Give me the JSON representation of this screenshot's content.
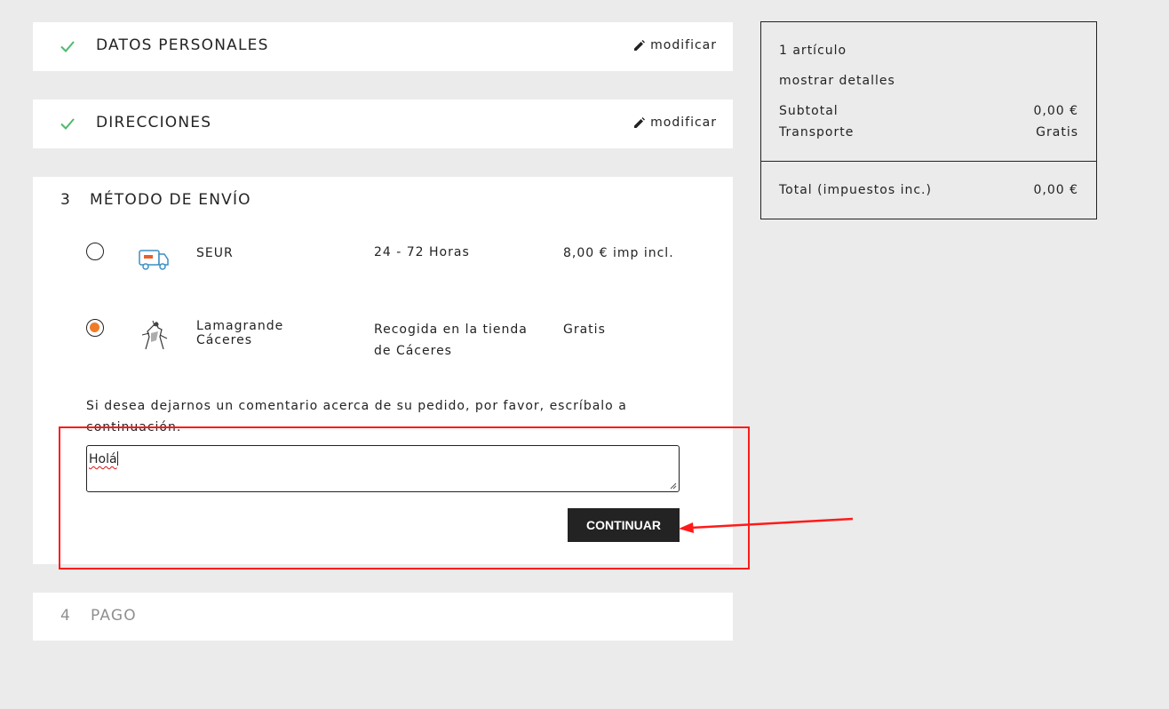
{
  "steps": {
    "personal": {
      "title": "DATOS PERSONALES",
      "modify_label": "modificar"
    },
    "addresses": {
      "title": "DIRECCIONES",
      "modify_label": "modificar"
    },
    "shipping": {
      "number": "3",
      "title": "MÉTODO DE ENVÍO",
      "carriers": [
        {
          "name": "SEUR",
          "delay": "24 - 72 Horas",
          "price": "8,00 € imp incl.",
          "selected": false,
          "logo_icon": "delivery-van-icon"
        },
        {
          "name_line1": "Lamagrande",
          "name_line2": "Cáceres",
          "delay_line1": "Recogida en la tienda",
          "delay_line2": "de Cáceres",
          "price": "Gratis",
          "selected": true,
          "logo_icon": "knight-logo-icon"
        }
      ],
      "comment_label": "Si desea dejarnos un comentario acerca de su pedido, por favor, escríbalo a continuación.",
      "comment_value": "Holá",
      "continue_label": "CONTINUAR"
    },
    "payment": {
      "number": "4",
      "title": "PAGO"
    }
  },
  "summary": {
    "items_count": "1 artículo",
    "show_details": "mostrar detalles",
    "subtotal_label": "Subtotal",
    "subtotal_value": "0,00 €",
    "shipping_label": "Transporte",
    "shipping_value": "Gratis",
    "total_label": "Total (impuestos inc.)",
    "total_value": "0,00 €"
  },
  "colors": {
    "check_green": "#4cbb6c",
    "radio_selected": "#f07c2a",
    "annotation_red": "#ff1a1a",
    "button_bg": "#232323"
  }
}
